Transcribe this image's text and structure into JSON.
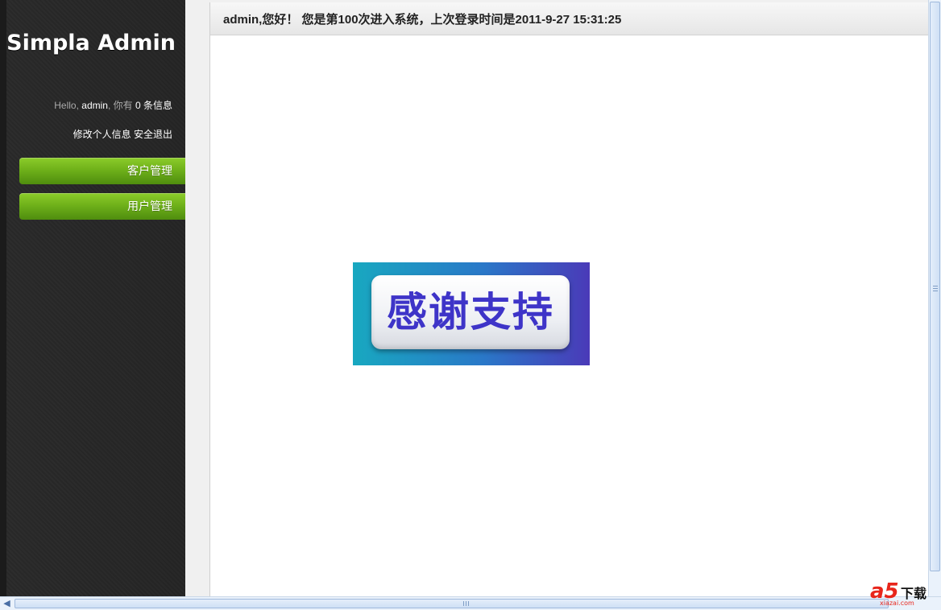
{
  "sidebar": {
    "logo": "Simpla Admin",
    "greeting_prefix": "Hello, ",
    "username": "admin",
    "greeting_mid": ", 你有 ",
    "message_count": "0",
    "greeting_suffix": " 条信息",
    "edit_profile_link": "修改个人信息",
    "logout_link": "安全退出",
    "nav": [
      {
        "label": "客户管理"
      },
      {
        "label": "用户管理"
      }
    ],
    "accent_color": "#6fb11a"
  },
  "main": {
    "welcome_text": "admin,您好！ 您是第100次进入系统，上次登录时间是2011-9-27 15:31:25",
    "banner_text": "感谢支持"
  },
  "watermark": {
    "mark": "a5",
    "text": "下载",
    "url": "xiazai.com"
  },
  "icons": {
    "scroll_left": "triangle-left-icon"
  }
}
